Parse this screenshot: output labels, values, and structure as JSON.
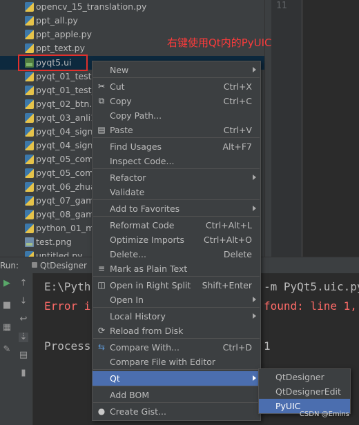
{
  "project_tree": {
    "items": [
      {
        "name": "opencv_15_translation.py",
        "type": "py"
      },
      {
        "name": "ppt_all.py",
        "type": "py"
      },
      {
        "name": "ppt_apple.py",
        "type": "py"
      },
      {
        "name": "ppt_text.py",
        "type": "py"
      },
      {
        "name": "pyqt5.ui",
        "type": "ui"
      },
      {
        "name": "pyqt_01_test.p",
        "type": "py"
      },
      {
        "name": "pyqt_01_test_1",
        "type": "py"
      },
      {
        "name": "pyqt_02_btn.py",
        "type": "py"
      },
      {
        "name": "pyqt_03_anli1.p",
        "type": "py"
      },
      {
        "name": "pyqt_04_signa",
        "type": "py"
      },
      {
        "name": "pyqt_04_signa",
        "type": "py"
      },
      {
        "name": "pyqt_05_comm",
        "type": "py"
      },
      {
        "name": "pyqt_05_comm",
        "type": "py"
      },
      {
        "name": "pyqt_06_zhuan",
        "type": "py"
      },
      {
        "name": "pyqt_07_game",
        "type": "py"
      },
      {
        "name": "pyqt_08_game",
        "type": "py"
      },
      {
        "name": "python_01_mo",
        "type": "py"
      },
      {
        "name": "test.png",
        "type": "png"
      },
      {
        "name": "untitled.py",
        "type": "py"
      }
    ]
  },
  "editor": {
    "line_number": "11"
  },
  "annotation": "右键使用Qt内的PyUIC",
  "run_panel": {
    "label": "Run:",
    "tab": "QtDesigner",
    "console_lines": [
      {
        "text": "E:\\Pyth",
        "suffix": "-m PyQt5.uic.py",
        "color": "#bbbbbb"
      },
      {
        "text": "Error i",
        "suffix": "found: line 1,",
        "color": "#ff6b68"
      },
      {
        "text": "",
        "suffix": "",
        "color": "#bbbbbb"
      },
      {
        "text": "Process",
        "suffix": "1",
        "color": "#bbbbbb"
      }
    ]
  },
  "context_menu": {
    "items": [
      {
        "label": "New",
        "shortcut": "",
        "submenu": true,
        "icon": ""
      },
      {
        "label": "Cut",
        "shortcut": "Ctrl+X",
        "submenu": false,
        "icon": "scissors-icon"
      },
      {
        "label": "Copy",
        "shortcut": "Ctrl+C",
        "submenu": false,
        "icon": "copy-icon"
      },
      {
        "label": "Copy Path...",
        "shortcut": "",
        "submenu": false,
        "icon": ""
      },
      {
        "label": "Paste",
        "shortcut": "Ctrl+V",
        "submenu": false,
        "icon": "paste-icon"
      },
      {
        "label": "Find Usages",
        "shortcut": "Alt+F7",
        "submenu": false,
        "icon": ""
      },
      {
        "label": "Inspect Code...",
        "shortcut": "",
        "submenu": false,
        "icon": ""
      },
      {
        "label": "Refactor",
        "shortcut": "",
        "submenu": true,
        "icon": ""
      },
      {
        "label": "Validate",
        "shortcut": "",
        "submenu": false,
        "icon": ""
      },
      {
        "label": "Add to Favorites",
        "shortcut": "",
        "submenu": true,
        "icon": ""
      },
      {
        "label": "Reformat Code",
        "shortcut": "Ctrl+Alt+L",
        "submenu": false,
        "icon": ""
      },
      {
        "label": "Optimize Imports",
        "shortcut": "Ctrl+Alt+O",
        "submenu": false,
        "icon": ""
      },
      {
        "label": "Delete...",
        "shortcut": "Delete",
        "submenu": false,
        "icon": ""
      },
      {
        "label": "Mark as Plain Text",
        "shortcut": "",
        "submenu": false,
        "icon": "plain-text-icon"
      },
      {
        "label": "Open in Right Split",
        "shortcut": "Shift+Enter",
        "submenu": false,
        "icon": "split-icon"
      },
      {
        "label": "Open In",
        "shortcut": "",
        "submenu": true,
        "icon": ""
      },
      {
        "label": "Local History",
        "shortcut": "",
        "submenu": true,
        "icon": ""
      },
      {
        "label": "Reload from Disk",
        "shortcut": "",
        "submenu": false,
        "icon": "reload-icon"
      },
      {
        "label": "Compare With...",
        "shortcut": "Ctrl+D",
        "submenu": false,
        "icon": "compare-icon"
      },
      {
        "label": "Compare File with Editor",
        "shortcut": "",
        "submenu": false,
        "icon": ""
      },
      {
        "label": "Qt",
        "shortcut": "",
        "submenu": true,
        "icon": "",
        "highlighted": true
      },
      {
        "label": "Add BOM",
        "shortcut": "",
        "submenu": false,
        "icon": ""
      },
      {
        "label": "Create Gist...",
        "shortcut": "",
        "submenu": false,
        "icon": "github-icon"
      }
    ]
  },
  "qt_submenu": {
    "items": [
      {
        "label": "QtDesigner",
        "highlighted": false
      },
      {
        "label": "QtDesignerEdit",
        "highlighted": false
      },
      {
        "label": "PyUIC",
        "highlighted": true
      }
    ]
  },
  "watermark": "CSDN @Emins",
  "colors": {
    "accent": "#4b6eaf",
    "annotation": "#ff3b3b",
    "error": "#ff6b68"
  }
}
